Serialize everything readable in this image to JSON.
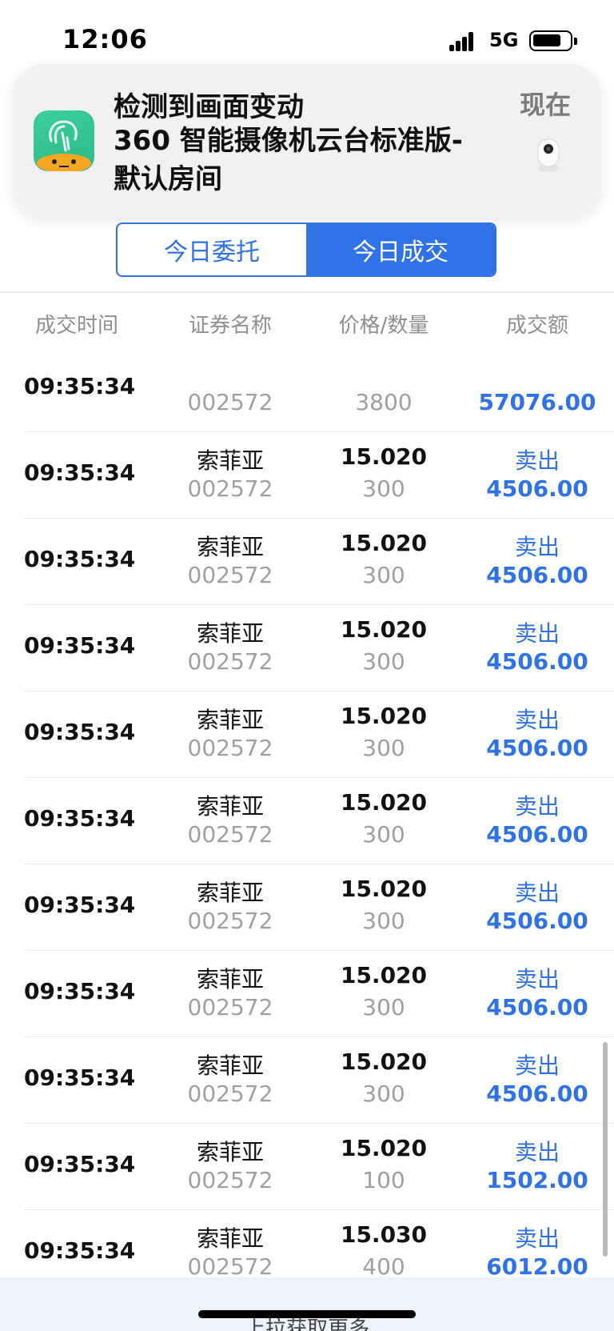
{
  "status_bar": {
    "time": "12:06",
    "network": "5G",
    "icons": [
      "signal-icon",
      "battery-icon"
    ]
  },
  "notification": {
    "app_icon": "app-icon",
    "title": "检测到画面变动",
    "body": "360 智能摄像机云台标准版-默认房间",
    "time": "现在",
    "thumbnail_icon": "camera-icon"
  },
  "tabs": [
    {
      "label": "今日委托",
      "active": false
    },
    {
      "label": "今日成交",
      "active": true
    }
  ],
  "table": {
    "headers": [
      "成交时间",
      "证券名称",
      "价格/数量",
      "成交额"
    ],
    "rows": [
      {
        "time": "09:35:34",
        "name": "",
        "code": "002572",
        "price": "",
        "qty": "3800",
        "direction": "",
        "amount": "57076.00"
      },
      {
        "time": "09:35:34",
        "name": "索菲亚",
        "code": "002572",
        "price": "15.020",
        "qty": "300",
        "direction": "卖出",
        "amount": "4506.00"
      },
      {
        "time": "09:35:34",
        "name": "索菲亚",
        "code": "002572",
        "price": "15.020",
        "qty": "300",
        "direction": "卖出",
        "amount": "4506.00"
      },
      {
        "time": "09:35:34",
        "name": "索菲亚",
        "code": "002572",
        "price": "15.020",
        "qty": "300",
        "direction": "卖出",
        "amount": "4506.00"
      },
      {
        "time": "09:35:34",
        "name": "索菲亚",
        "code": "002572",
        "price": "15.020",
        "qty": "300",
        "direction": "卖出",
        "amount": "4506.00"
      },
      {
        "time": "09:35:34",
        "name": "索菲亚",
        "code": "002572",
        "price": "15.020",
        "qty": "300",
        "direction": "卖出",
        "amount": "4506.00"
      },
      {
        "time": "09:35:34",
        "name": "索菲亚",
        "code": "002572",
        "price": "15.020",
        "qty": "300",
        "direction": "卖出",
        "amount": "4506.00"
      },
      {
        "time": "09:35:34",
        "name": "索菲亚",
        "code": "002572",
        "price": "15.020",
        "qty": "300",
        "direction": "卖出",
        "amount": "4506.00"
      },
      {
        "time": "09:35:34",
        "name": "索菲亚",
        "code": "002572",
        "price": "15.020",
        "qty": "300",
        "direction": "卖出",
        "amount": "4506.00"
      },
      {
        "time": "09:35:34",
        "name": "索菲亚",
        "code": "002572",
        "price": "15.020",
        "qty": "100",
        "direction": "卖出",
        "amount": "1502.00"
      },
      {
        "time": "09:35:34",
        "name": "索菲亚",
        "code": "002572",
        "price": "15.030",
        "qty": "400",
        "direction": "卖出",
        "amount": "6012.00"
      }
    ]
  },
  "footer": {
    "load_more": "上拉获取更多"
  },
  "colors": {
    "accent": "#2f71e6",
    "muted": "#a0a0a0",
    "header_text": "#8f8f8f"
  }
}
